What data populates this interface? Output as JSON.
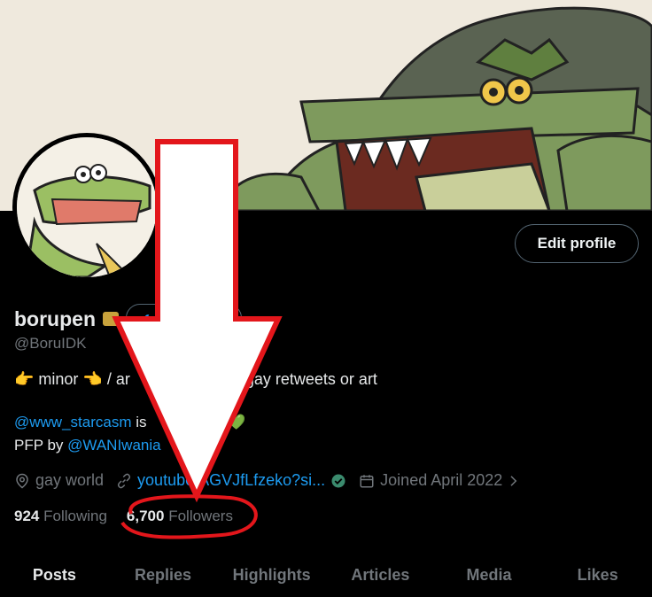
{
  "header": {
    "banner_alt": "crocodile banner art",
    "avatar_alt": "crocodile avatar"
  },
  "actions": {
    "edit_profile": "Edit profile"
  },
  "profile": {
    "name": "borupen",
    "verify_badge_text": "Get verified",
    "handle": "@BoruIDK",
    "bio_line1_a": "👉 minor 👈 / ar",
    "bio_line1_b": "gay retweets or art",
    "bio_line2_mention": "@www_starcasm",
    "bio_line2_text": "is",
    "bio_line2_hearts": "💚💚",
    "bio_line3_text": "PFP by",
    "bio_line3_mention": "@WANIwania"
  },
  "meta": {
    "location": "gay world",
    "website": "youtube/AGVJfLfzeko?si...",
    "joined": "Joined April 2022"
  },
  "stats": {
    "following_count": "924",
    "following_label": "Following",
    "followers_count": "6,700",
    "followers_label": "Followers"
  },
  "tabs": [
    "Posts",
    "Replies",
    "Highlights",
    "Articles",
    "Media",
    "Likes"
  ],
  "colors": {
    "accent_link": "#1d9bf0",
    "annotation_red": "#e3161b",
    "secondary_text": "#71767b"
  },
  "icons": [
    "location-icon",
    "link-icon",
    "verified-check-icon",
    "calendar-icon",
    "chevron-right-icon"
  ]
}
